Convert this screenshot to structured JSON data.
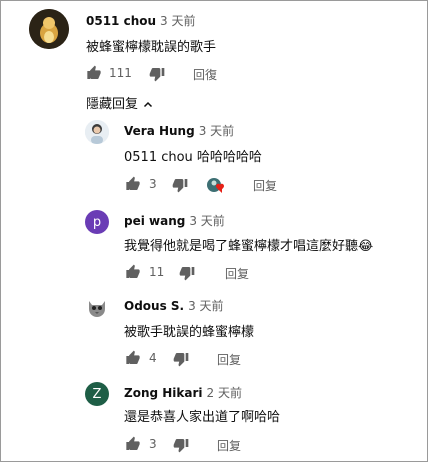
{
  "top_comment": {
    "author": "0511 chou",
    "time": "3 天前",
    "text": "被蜂蜜檸檬耽誤的歌手",
    "likes": "111",
    "reply_label": "回復"
  },
  "replies_toggle": {
    "label": "隱藏回复"
  },
  "replies": [
    {
      "author": "Vera Hung",
      "time": "3 天前",
      "text": "0511 chou 哈哈哈哈哈",
      "likes": "3",
      "reply_label": "回复",
      "creator_heart": true
    },
    {
      "author": "pei wang",
      "time": "3 天前",
      "text": "我覺得他就是喝了蜂蜜檸檬才唱這麼好聽😂",
      "likes": "11",
      "reply_label": "回复",
      "avatar_letter": "p",
      "avatar_color": "#6a3cb5"
    },
    {
      "author": "Odous S.",
      "time": "3 天前",
      "text": "被歌手耽誤的蜂蜜檸檬",
      "likes": "4",
      "reply_label": "回复"
    },
    {
      "author": "Zong Hikari",
      "time": "2 天前",
      "text": "還是恭喜人家出道了啊哈哈",
      "likes": "3",
      "reply_label": "回复",
      "avatar_letter": "Z",
      "avatar_color": "#1e5e46"
    }
  ]
}
